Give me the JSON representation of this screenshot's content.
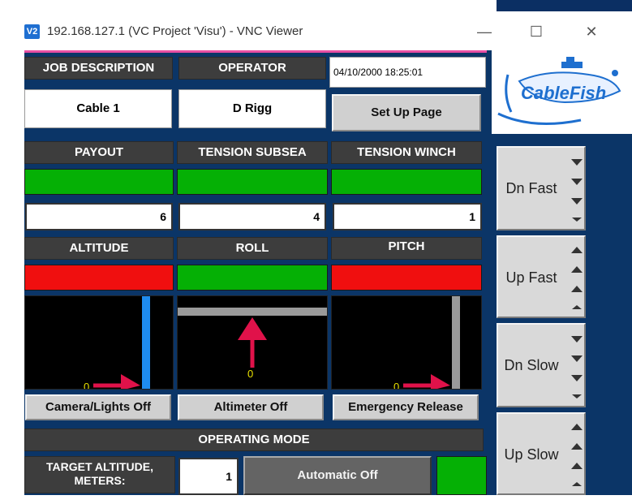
{
  "window": {
    "app_icon_text": "V2",
    "title": "192.168.127.1 (VC Project 'Visu') - VNC Viewer",
    "minimize_glyph": "—",
    "maximize_glyph": "☐",
    "close_glyph": "✕"
  },
  "header": {
    "job_description_label": "JOB DESCRIPTION",
    "job_description_value": "Cable 1",
    "operator_label": "OPERATOR",
    "operator_value": "D Rigg",
    "datetime": "04/10/2000 18:25:01",
    "setup_button": "Set Up Page",
    "logo_text": "CableFish"
  },
  "sensors_row1": {
    "payout_label": "PAYOUT",
    "payout_value": "6",
    "payout_status_color": "#05b005",
    "tension_subsea_label": "TENSION SUBSEA",
    "tension_subsea_value": "4",
    "tension_subsea_status_color": "#05b005",
    "tension_winch_label": "TENSION WINCH",
    "tension_winch_value": "1",
    "tension_winch_status_color": "#05b005"
  },
  "sensors_row2": {
    "altitude_label": "ALTITUDE",
    "altitude_status_color": "#f00f0f",
    "roll_label": "ROLL",
    "roll_status_color": "#05b005",
    "pitch_label": "PITCH",
    "pitch_status_color": "#f00f0f",
    "altitude_marker": "0",
    "roll_marker": "0",
    "pitch_marker": "0"
  },
  "actions": {
    "camera_button": "Camera/Lights Off",
    "altimeter_button": "Altimeter Off",
    "emergency_button": "Emergency Release"
  },
  "operating_mode": {
    "label": "OPERATING MODE",
    "target_altitude_label_line1": "TARGET ALTITUDE,",
    "target_altitude_label_line2": "METERS:",
    "target_altitude_value": "1",
    "automatic_button": "Automatic Off",
    "status_color": "#05b005"
  },
  "jog_buttons": {
    "dn_fast": "Dn Fast",
    "up_fast": "Up Fast",
    "dn_slow": "Dn Slow",
    "up_slow": "Up Slow"
  },
  "colors": {
    "background": "#0b3567",
    "header_dark": "#3d3d3d",
    "ok": "#05b005",
    "alarm": "#f00f0f",
    "accent_pink": "#e84fa4",
    "indicator_blue": "#1e8cf0",
    "arrow_red": "#e0124a"
  }
}
